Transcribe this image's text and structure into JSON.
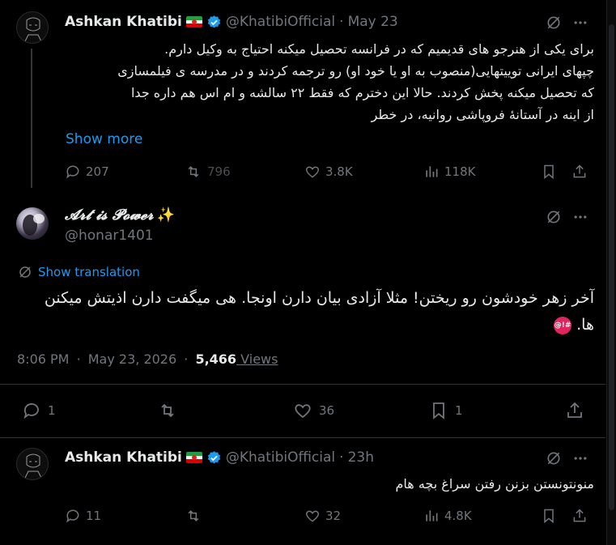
{
  "tweet1": {
    "author_name": "Ashkan Khatibi",
    "handle": "@KhatibiOfficial",
    "separator": "·",
    "date": "May 23",
    "lines": [
      "برای یکی از هنرجو های قدیمیم که در فرانسه تحصیل میکنه احتیاج به وکیل دارم.",
      "چپهای ایرانی توییتهایی(منصوب به او یا خود او) رو ترجمه کردند و در مدرسه ی فیلمسازی",
      "که تحصیل میکنه پخش کردند. حالا این دخترم که فقط ۲۲ سالشه و ام اس هم داره جدا",
      "از اینه در آستانهٔ فروپاشی روانیه، در خطر"
    ],
    "show_more": "Show more",
    "replies": "207",
    "reposts": "796",
    "likes": "3.8K",
    "views": "118K"
  },
  "tweet2": {
    "author_name": "𝓐𝓻𝓽 𝓲𝓼 𝓟𝓸𝔀𝓮𝓻",
    "sparkle": "✨",
    "handle": "@honar1401",
    "show_translation": "Show translation",
    "text_line1": "آخر زهر خودشون رو ریختن! مثلا آزادی بیان دارن اونجا. هی میگفت دارن اذیتش میکنن",
    "text_line2": "ها.",
    "time": "8:06 PM",
    "separator": "·",
    "date": "May 23, 2026",
    "separator2": "·",
    "views_count": "5,466",
    "views_label": " Views",
    "replies": "1",
    "reposts": "",
    "likes": "36",
    "bookmarks": "1"
  },
  "tweet3": {
    "author_name": "Ashkan Khatibi",
    "handle": "@KhatibiOfficial",
    "separator": "·",
    "date": "23h",
    "text": "منونتونستن بزنن رفتن سراغ بچه هام",
    "replies": "11",
    "likes": "32",
    "views": "4.8K"
  },
  "colors": {
    "background": "#000000",
    "text": "#e7e9ea",
    "muted": "#71767b",
    "link": "#1d9bf0",
    "verified": "#1d9bf0",
    "divider": "#2f3336"
  },
  "icons": [
    "grok-icon",
    "more-icon",
    "reply-icon",
    "repost-icon",
    "like-icon",
    "views-icon",
    "bookmark-icon",
    "share-icon",
    "verified-icon",
    "flag-iran-icon",
    "translate-icon"
  ]
}
